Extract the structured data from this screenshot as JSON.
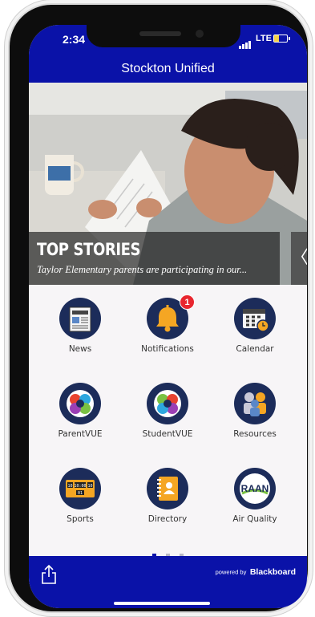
{
  "status": {
    "time": "2:34",
    "network": "LTE"
  },
  "header": {
    "title": "Stockton Unified"
  },
  "hero": {
    "title": "TOP STORIES",
    "subtitle": "Taylor Elementary parents are participating in our..."
  },
  "tiles": [
    {
      "label": "News",
      "icon": "newspaper-icon"
    },
    {
      "label": "Notifications",
      "icon": "bell-icon",
      "badge": "1"
    },
    {
      "label": "Calendar",
      "icon": "calendar-icon"
    },
    {
      "label": "ParentVUE",
      "icon": "parentvue-icon"
    },
    {
      "label": "StudentVUE",
      "icon": "studentvue-icon"
    },
    {
      "label": "Resources",
      "icon": "people-icon"
    },
    {
      "label": "Sports",
      "icon": "scoreboard-icon"
    },
    {
      "label": "Directory",
      "icon": "address-book-icon"
    },
    {
      "label": "Air Quality",
      "icon": "raan-icon",
      "icon_text": "RAAN"
    }
  ],
  "scoreboard": {
    "left": "10",
    "time": "10:00",
    "right": "10",
    "period": "01"
  },
  "pagination": {
    "total": 3,
    "active": 1
  },
  "footer": {
    "powered_prefix": "powered by",
    "brand": "Blackboard"
  },
  "colors": {
    "primary": "#0a12a8",
    "icon_bg": "#1c2c5a",
    "badge": "#e8262f"
  }
}
